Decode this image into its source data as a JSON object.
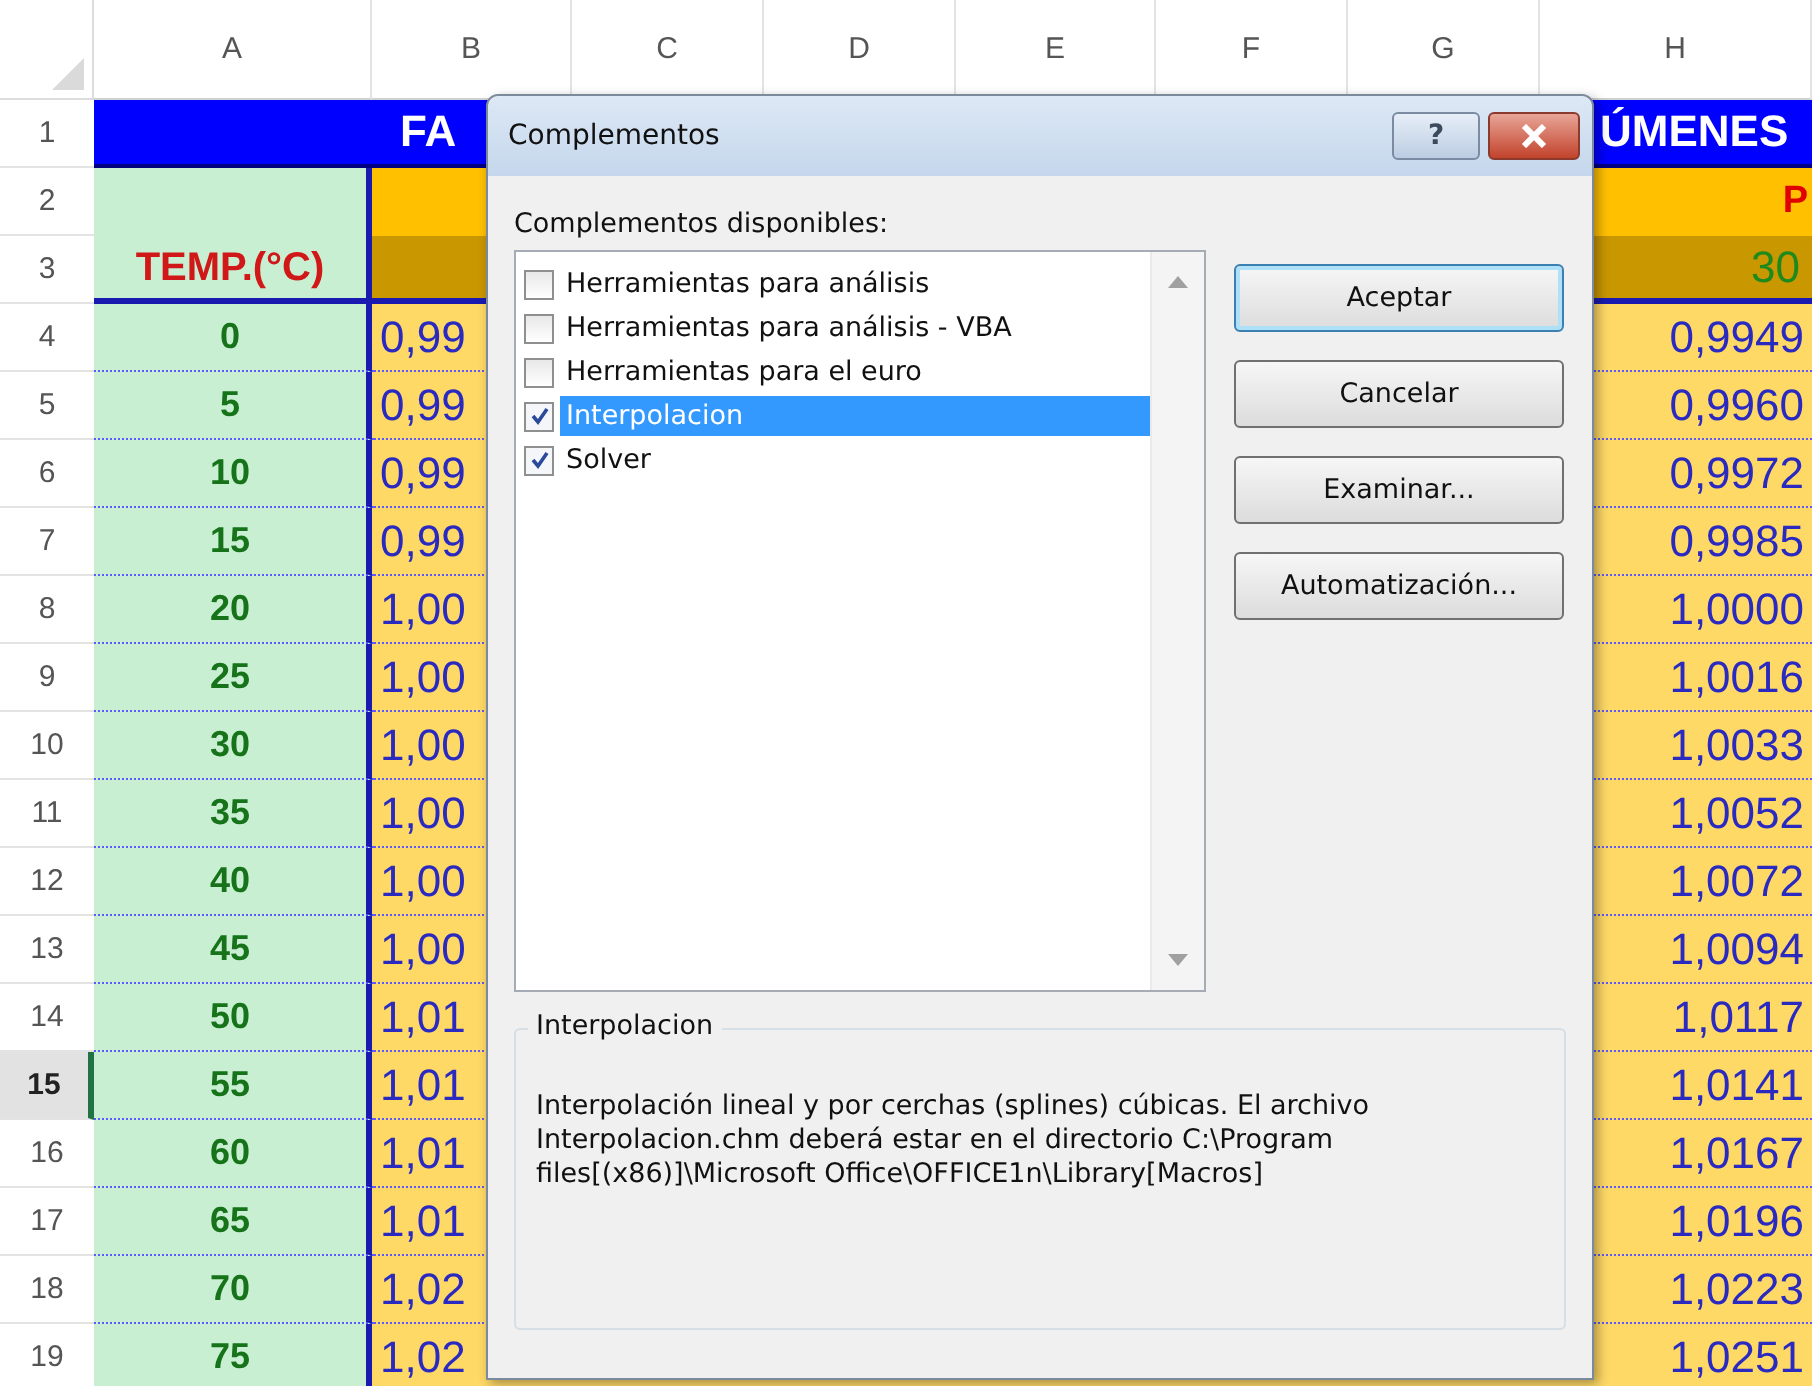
{
  "sheet": {
    "columns": [
      "A",
      "B",
      "C",
      "D",
      "E",
      "F",
      "G",
      "H"
    ],
    "rows": [
      {
        "label": "1",
        "selected": false
      },
      {
        "label": "2",
        "selected": false
      },
      {
        "label": "3",
        "selected": false
      },
      {
        "label": "4",
        "selected": false
      },
      {
        "label": "5",
        "selected": false
      },
      {
        "label": "6",
        "selected": false
      },
      {
        "label": "7",
        "selected": false
      },
      {
        "label": "8",
        "selected": false
      },
      {
        "label": "9",
        "selected": false
      },
      {
        "label": "10",
        "selected": false
      },
      {
        "label": "11",
        "selected": false
      },
      {
        "label": "12",
        "selected": false
      },
      {
        "label": "13",
        "selected": false
      },
      {
        "label": "14",
        "selected": false
      },
      {
        "label": "15",
        "selected": true
      },
      {
        "label": "16",
        "selected": false
      },
      {
        "label": "17",
        "selected": false
      },
      {
        "label": "18",
        "selected": false
      },
      {
        "label": "19",
        "selected": false
      }
    ],
    "title_left": "FA",
    "title_right": "ÚMENES",
    "header_h2": "P",
    "header_temp": "TEMP.(°C)",
    "header_h3": "30",
    "data": [
      {
        "temp": "0",
        "col_b": "0,99",
        "col_h": "0,9949"
      },
      {
        "temp": "5",
        "col_b": "0,99",
        "col_h": "0,9960"
      },
      {
        "temp": "10",
        "col_b": "0,99",
        "col_h": "0,9972"
      },
      {
        "temp": "15",
        "col_b": "0,99",
        "col_h": "0,9985"
      },
      {
        "temp": "20",
        "col_b": "1,00",
        "col_h": "1,0000"
      },
      {
        "temp": "25",
        "col_b": "1,00",
        "col_h": "1,0016"
      },
      {
        "temp": "30",
        "col_b": "1,00",
        "col_h": "1,0033"
      },
      {
        "temp": "35",
        "col_b": "1,00",
        "col_h": "1,0052"
      },
      {
        "temp": "40",
        "col_b": "1,00",
        "col_h": "1,0072"
      },
      {
        "temp": "45",
        "col_b": "1,00",
        "col_h": "1,0094"
      },
      {
        "temp": "50",
        "col_b": "1,01",
        "col_h": "1,0117"
      },
      {
        "temp": "55",
        "col_b": "1,01",
        "col_h": "1,0141"
      },
      {
        "temp": "60",
        "col_b": "1,01",
        "col_h": "1,0167"
      },
      {
        "temp": "65",
        "col_b": "1,01",
        "col_h": "1,0196"
      },
      {
        "temp": "70",
        "col_b": "1,02",
        "col_h": "1,0223"
      },
      {
        "temp": "75",
        "col_b": "1,02",
        "col_h": "1,0251"
      }
    ]
  },
  "dialog": {
    "title": "Complementos",
    "help": "?",
    "list_label": "Complementos disponibles:",
    "addins": [
      {
        "label": "Herramientas para análisis",
        "checked": false,
        "selected": false
      },
      {
        "label": "Herramientas para análisis - VBA",
        "checked": false,
        "selected": false
      },
      {
        "label": "Herramientas para el euro",
        "checked": false,
        "selected": false
      },
      {
        "label": "Interpolacion",
        "checked": true,
        "selected": true
      },
      {
        "label": "Solver",
        "checked": true,
        "selected": false
      }
    ],
    "buttons": [
      {
        "label": "Aceptar",
        "default": true
      },
      {
        "label": "Cancelar",
        "default": false
      },
      {
        "label": "Examinar...",
        "default": false
      },
      {
        "label": "Automatización...",
        "default": false
      }
    ],
    "description": {
      "title": "Interpolacion",
      "text": "Interpolación lineal y por cerchas (splines) cúbicas. El archivo Interpolacion.chm deberá estar en el directorio C:\\Program files[(x86)]\\Microsoft Office\\OFFICE1n\\Library[Macros]"
    }
  }
}
